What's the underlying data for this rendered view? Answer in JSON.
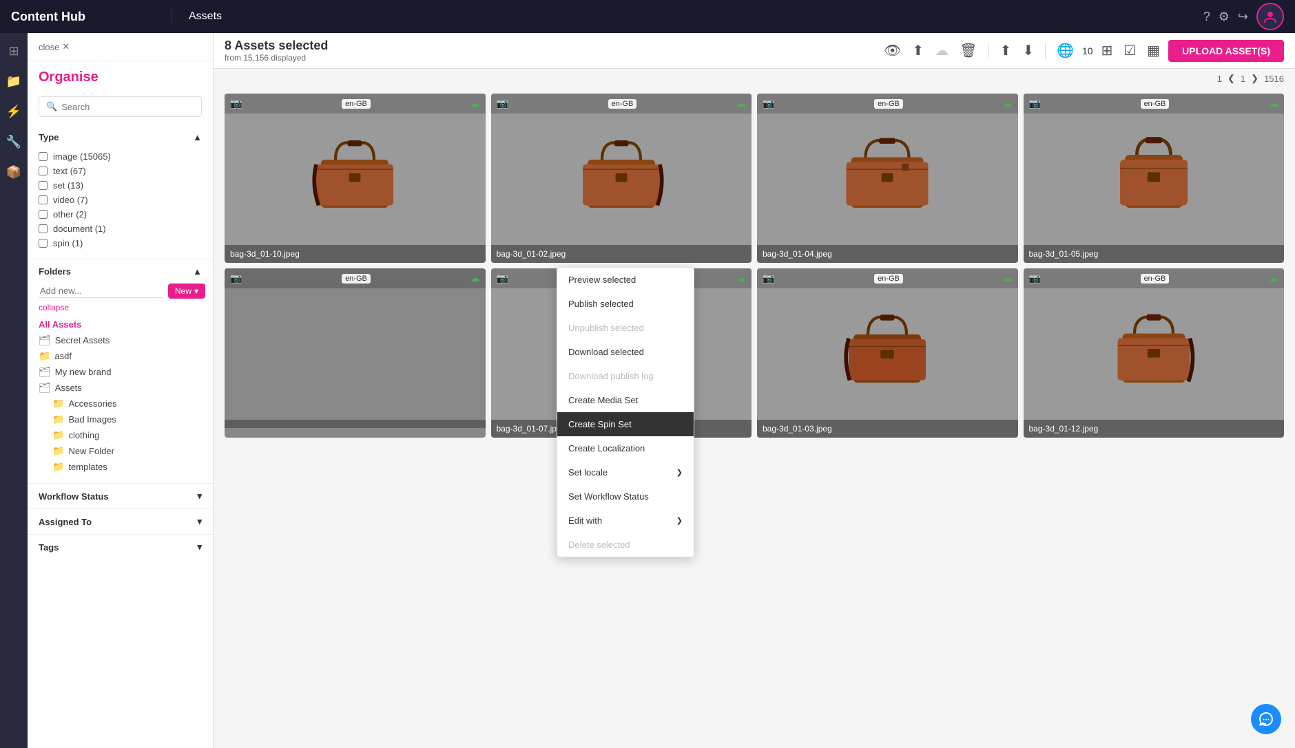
{
  "app": {
    "name": "Content Hub",
    "page_title": "Assets"
  },
  "toolbar": {
    "selected_text": "8 Assets selected",
    "selected_sub": "from 15,156 displayed",
    "count": "10",
    "upload_btn": "UPLOAD ASSET(S)",
    "page_current": "1",
    "page_total": "1516"
  },
  "left_panel": {
    "close_label": "close",
    "title": "Organise",
    "search_placeholder": "Search",
    "type_section": {
      "label": "Type",
      "items": [
        {
          "label": "image (15065)"
        },
        {
          "label": "text (67)"
        },
        {
          "label": "set (13)"
        },
        {
          "label": "video (7)"
        },
        {
          "label": "other (2)"
        },
        {
          "label": "document (1)"
        },
        {
          "label": "spin (1)"
        }
      ]
    },
    "folders_section": {
      "label": "Folders",
      "add_placeholder": "Add new...",
      "new_btn": "New",
      "collapse": "collapse",
      "all_assets": "All Assets",
      "items": [
        {
          "label": "Secret Assets",
          "type": "folder"
        },
        {
          "label": "asdf",
          "type": "folder"
        },
        {
          "label": "My new brand",
          "type": "folder"
        },
        {
          "label": "Assets",
          "type": "folder"
        },
        {
          "label": "Accessories",
          "type": "subfolder"
        },
        {
          "label": "Bad Images",
          "type": "subfolder"
        },
        {
          "label": "clothing",
          "type": "subfolder"
        },
        {
          "label": "New Folder",
          "type": "subfolder"
        },
        {
          "label": "templates",
          "type": "subfolder"
        }
      ]
    },
    "workflow_section": {
      "label": "Workflow Status"
    },
    "assigned_section": {
      "label": "Assigned To"
    },
    "tags_section": {
      "label": "Tags"
    }
  },
  "context_menu": {
    "items": [
      {
        "label": "Preview selected",
        "disabled": false,
        "highlighted": false,
        "arrow": false
      },
      {
        "label": "Publish selected",
        "disabled": false,
        "highlighted": false,
        "arrow": false
      },
      {
        "label": "Unpublish selected",
        "disabled": true,
        "highlighted": false,
        "arrow": false
      },
      {
        "label": "Download selected",
        "disabled": false,
        "highlighted": false,
        "arrow": false
      },
      {
        "label": "Download publish log",
        "disabled": true,
        "highlighted": false,
        "arrow": false
      },
      {
        "label": "Create Media Set",
        "disabled": false,
        "highlighted": false,
        "arrow": false
      },
      {
        "label": "Create Spin Set",
        "disabled": false,
        "highlighted": true,
        "arrow": false
      },
      {
        "label": "Create Localization",
        "disabled": false,
        "highlighted": false,
        "arrow": false
      },
      {
        "label": "Set locale",
        "disabled": false,
        "highlighted": false,
        "arrow": true
      },
      {
        "label": "Set Workflow Status",
        "disabled": false,
        "highlighted": false,
        "arrow": false
      },
      {
        "label": "Edit with",
        "disabled": false,
        "highlighted": false,
        "arrow": true
      },
      {
        "label": "Delete selected",
        "disabled": true,
        "highlighted": false,
        "arrow": false
      }
    ]
  },
  "assets": [
    {
      "name": "bag-3d_01-10.jpeg"
    },
    {
      "name": "bag-3d_01-02.jpeg"
    },
    {
      "name": "bag-3d_01-04.jpeg"
    },
    {
      "name": "bag-3d_01-05.jpeg"
    },
    {
      "name": "bag-3d_01-07.jpeg"
    },
    {
      "name": "bag-3d_01-03.jpeg"
    },
    {
      "name": "bag-3d_01-12.jpeg"
    }
  ],
  "icons": {
    "eye": "👁",
    "upload": "⬆",
    "sort_up": "▲",
    "sort_down": "▼",
    "globe": "🌐",
    "grid": "⊞",
    "check": "☑",
    "chevron_right": "❯",
    "chevron_down": "▾",
    "chevron_left": "❮",
    "close": "✕",
    "folder": "🗂",
    "page_folder": "📁",
    "search": "🔍",
    "camera": "📷",
    "cloud": "☁",
    "trash": "🗑",
    "download": "⬇",
    "settings": "⚙",
    "logout": "↪",
    "help": "?",
    "chat": "💬"
  }
}
